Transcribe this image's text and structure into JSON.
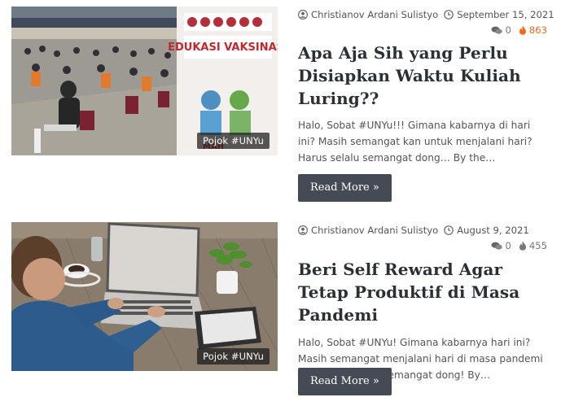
{
  "posts": [
    {
      "category": "Pojok #UNYu",
      "image_text": "EDUKASI VAKSINASI",
      "author": "Christianov Ardani Sulistyo",
      "date": "September 15, 2021",
      "comments": "0",
      "views": "863",
      "views_hot": true,
      "title": "Apa Aja Sih yang Perlu Disiapkan Waktu Kuliah Luring??",
      "excerpt": "Halo, Sobat #UNYu!!! Gimana kabarnya di hari ini? Masih semangat kan untuk menjalani hari? Harus selalu semangat dong… By the…",
      "read_more": "Read More »"
    },
    {
      "category": "Pojok #UNYu",
      "author": "Christianov Ardani Sulistyo",
      "date": "August 9, 2021",
      "comments": "0",
      "views": "455",
      "views_hot": false,
      "title": "Beri Self Reward Agar Tetap Produktif di Masa Pandemi",
      "excerpt": "Halo, Sobat #UNYu! Gimana kabarnya hari ini? Masih semangat menjalani hari di masa pandemi ini? Harus selalu semangat dong! By…",
      "read_more": "Read More »"
    }
  ],
  "colors": {
    "button_bg": "#454b55",
    "hot_views": "#f26b1d",
    "meta_text": "#555555"
  },
  "icons": [
    "user-icon",
    "clock-icon",
    "comments-icon",
    "fire-icon"
  ]
}
